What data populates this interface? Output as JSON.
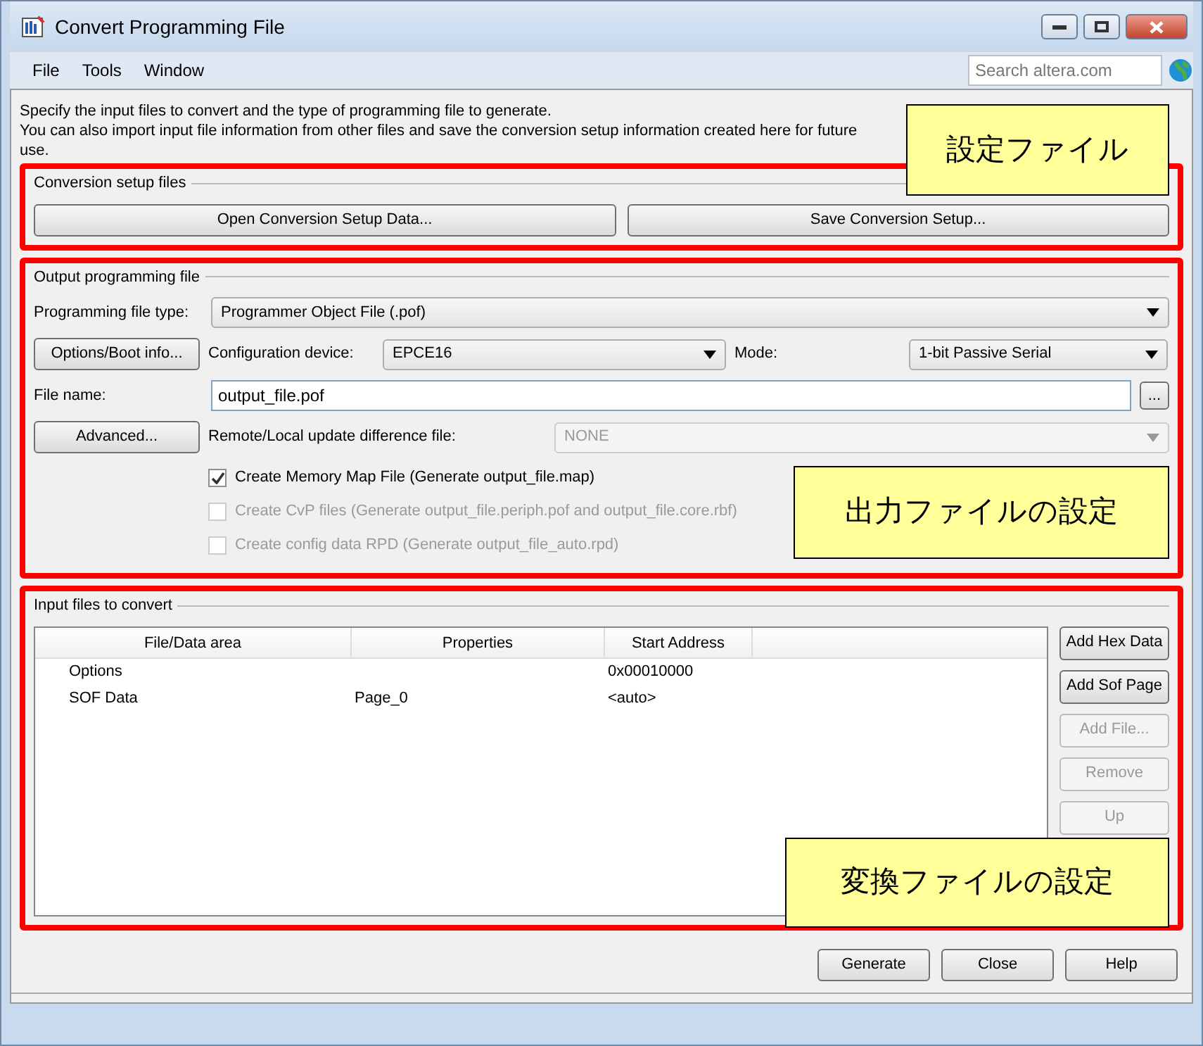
{
  "window": {
    "title": "Convert Programming File"
  },
  "menu": [
    {
      "label": "File"
    },
    {
      "label": "Tools"
    },
    {
      "label": "Window"
    }
  ],
  "search": {
    "placeholder": "Search altera.com"
  },
  "description": "Specify the input files to convert and the type of programming file to generate.\nYou can also import input file information from other files and save the conversion setup information created here for future use.",
  "setup": {
    "title": "Conversion setup files",
    "buttons": [
      "Open Conversion Setup Data...",
      "Save Conversion Setup..."
    ]
  },
  "output": {
    "title": "Output programming file",
    "file_type": {
      "label": "Programming file type:",
      "value": "Programmer Object File (.pof)"
    },
    "options_button": "Options/Boot info...",
    "device": {
      "label": "Configuration device:",
      "value": "EPCE16"
    },
    "mode": {
      "label": "Mode:",
      "value": "1-bit Passive Serial"
    },
    "file_name": {
      "label": "File name:",
      "value": "output_file.pof",
      "browse": "..."
    },
    "advanced_button": "Advanced...",
    "remote": {
      "label": "Remote/Local update difference file:",
      "value": "NONE",
      "disabled": true
    },
    "checkboxes": [
      {
        "label": "Create Memory Map File (Generate output_file.map)",
        "checked": true,
        "disabled": false
      },
      {
        "label": "Create CvP files (Generate output_file.periph.pof and output_file.core.rbf)",
        "checked": false,
        "disabled": true
      },
      {
        "label": "Create config data RPD (Generate output_file_auto.rpd)",
        "checked": false,
        "disabled": true
      }
    ]
  },
  "input": {
    "title": "Input files to convert",
    "table": {
      "columns": [
        "File/Data area",
        "Properties",
        "Start Address"
      ],
      "rows": [
        [
          "Options",
          "",
          "0x00010000"
        ],
        [
          "SOF Data",
          "Page_0",
          "<auto>"
        ]
      ]
    },
    "buttons": [
      {
        "label": "Add Hex Data",
        "disabled": false
      },
      {
        "label": "Add Sof Page",
        "disabled": false
      },
      {
        "label": "Add File...",
        "disabled": true
      },
      {
        "label": "Remove",
        "disabled": true
      },
      {
        "label": "Up",
        "disabled": true
      }
    ]
  },
  "footer_buttons": [
    "Generate",
    "Close",
    "Help"
  ],
  "annotations": [
    {
      "text": "設定ファイル"
    },
    {
      "text": "出力ファイルの設定"
    },
    {
      "text": "変換ファイルの設定"
    }
  ]
}
